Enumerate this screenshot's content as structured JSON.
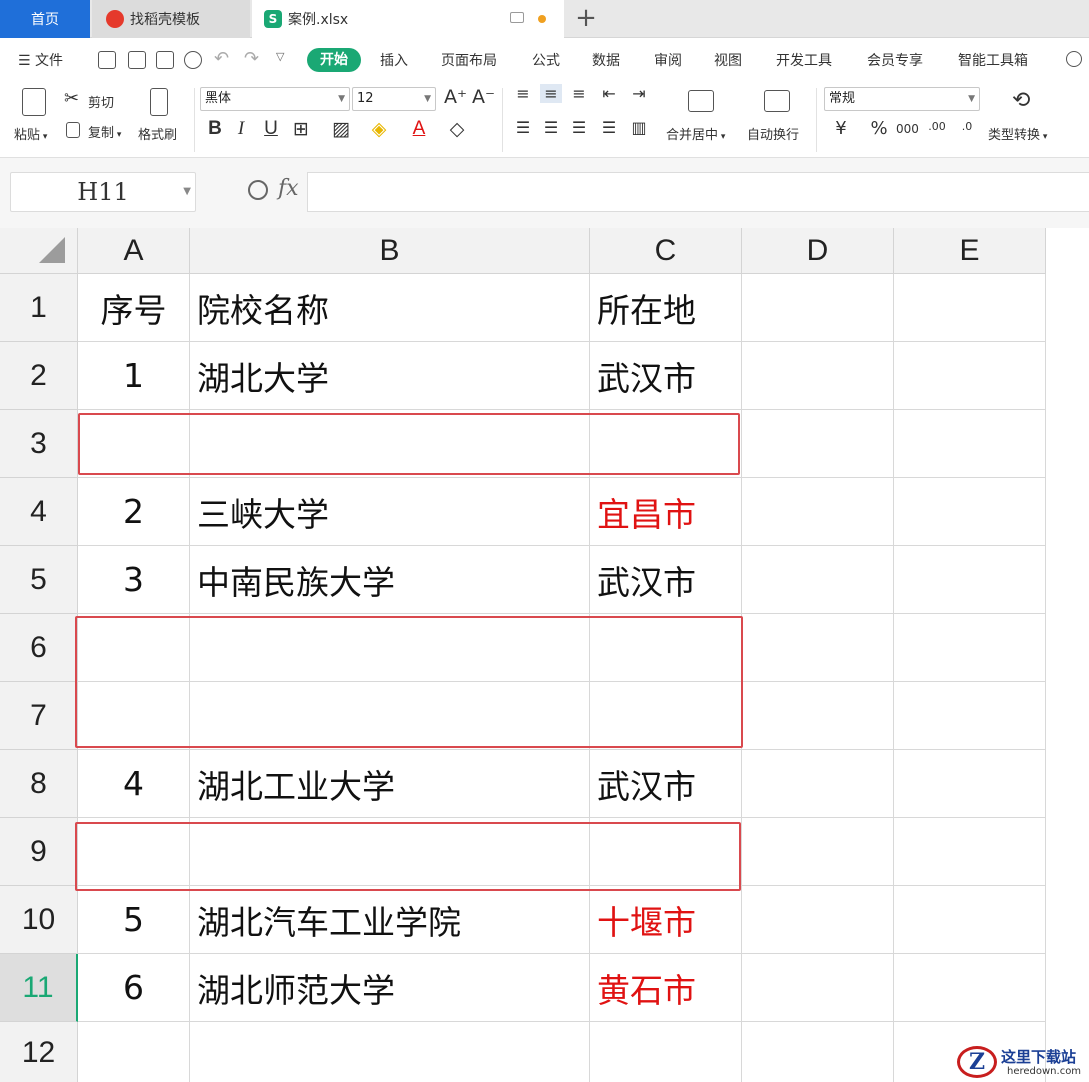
{
  "tabs": {
    "home": "首页",
    "doc": "找稻壳模板",
    "file": "案例.xlsx",
    "file_icon": "S",
    "new_tab": "+"
  },
  "menu": {
    "file": "文件",
    "items": [
      "开始",
      "插入",
      "页面布局",
      "公式",
      "数据",
      "审阅",
      "视图",
      "开发工具",
      "会员专享",
      "智能工具箱"
    ]
  },
  "ribbon": {
    "paste": "粘贴",
    "cut": "剪切",
    "copy": "复制",
    "format_painter": "格式刷",
    "font_name": "黑体",
    "font_size": "12",
    "merge_center": "合并居中",
    "wrap_text": "自动换行",
    "number_format": "常规",
    "type_convert": "类型转换",
    "currency": "¥",
    "percent": "%"
  },
  "formula_bar": {
    "cell_ref": "H11",
    "fx": "fx",
    "formula": ""
  },
  "columns": [
    "A",
    "B",
    "C",
    "D",
    "E"
  ],
  "rows": [
    {
      "n": "1",
      "a": "序号",
      "b": "院校名称",
      "c": "所在地",
      "c_red": false
    },
    {
      "n": "2",
      "a": "1",
      "b": "湖北大学",
      "c": "武汉市",
      "c_red": false
    },
    {
      "n": "3",
      "a": "",
      "b": "",
      "c": "",
      "c_red": false
    },
    {
      "n": "4",
      "a": "2",
      "b": "三峡大学",
      "c": "宜昌市",
      "c_red": true
    },
    {
      "n": "5",
      "a": "3",
      "b": "中南民族大学",
      "c": "武汉市",
      "c_red": false
    },
    {
      "n": "6",
      "a": "",
      "b": "",
      "c": "",
      "c_red": false
    },
    {
      "n": "7",
      "a": "",
      "b": "",
      "c": "",
      "c_red": false
    },
    {
      "n": "8",
      "a": "4",
      "b": "湖北工业大学",
      "c": "武汉市",
      "c_red": false
    },
    {
      "n": "9",
      "a": "",
      "b": "",
      "c": "",
      "c_red": false
    },
    {
      "n": "10",
      "a": "5",
      "b": "湖北汽车工业学院",
      "c": "十堰市",
      "c_red": true
    },
    {
      "n": "11",
      "a": "6",
      "b": "湖北师范大学",
      "c": "黄石市",
      "c_red": true
    },
    {
      "n": "12",
      "a": "",
      "b": "",
      "c": "",
      "c_red": false
    }
  ],
  "active_row": "11",
  "watermark": {
    "logo": "Z",
    "title": "这里下载站",
    "url": "heredown.com"
  }
}
